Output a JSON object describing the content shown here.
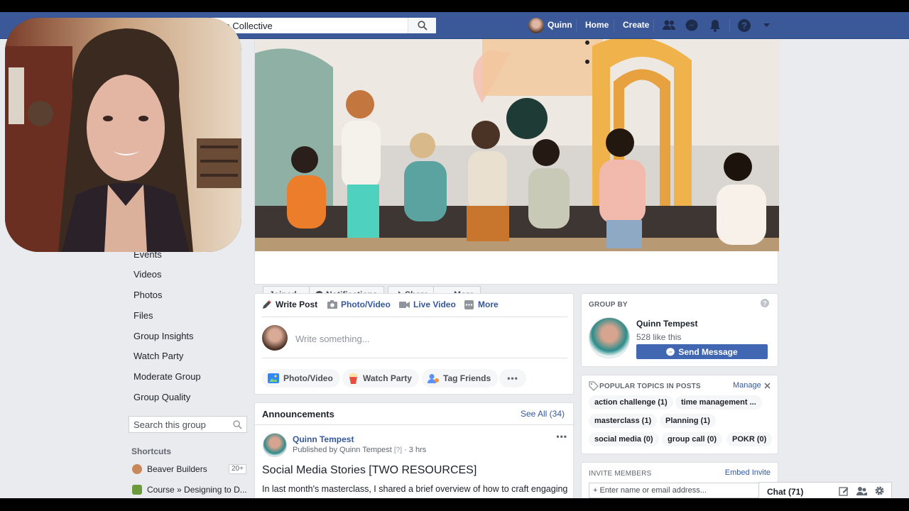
{
  "topbar": {
    "search_value": "urpose Collective",
    "user_name": "Quinn",
    "home": "Home",
    "create": "Create"
  },
  "left_nav": {
    "items": [
      "Events",
      "Videos",
      "Photos",
      "Files",
      "Group Insights",
      "Watch Party",
      "Moderate Group",
      "Group Quality"
    ],
    "search_placeholder": "Search this group",
    "shortcuts_title": "Shortcuts",
    "shortcuts": [
      {
        "label": "Beaver Builders",
        "badge": "20+"
      },
      {
        "label": "Course » Designing to D..."
      }
    ]
  },
  "cover_actions": {
    "joined": "Joined",
    "notifications": "Notifications",
    "share": "Share",
    "more": "More"
  },
  "composer": {
    "tabs": [
      "Write Post",
      "Photo/Video",
      "Live Video",
      "More"
    ],
    "placeholder": "Write something...",
    "pills": [
      "Photo/Video",
      "Watch Party",
      "Tag Friends"
    ]
  },
  "announcements": {
    "title": "Announcements",
    "see_all": "See All (34)",
    "author": "Quinn Tempest",
    "meta_prefix": "Published by Quinn Tempest",
    "meta_badge": "[?]",
    "meta_time": "· 3 hrs",
    "post_title": "Social Media Stories [TWO RESOURCES]",
    "post_text": "In last month's masterclass, I shared a brief overview of how to craft engaging"
  },
  "group_by": {
    "header": "GROUP BY",
    "name": "Quinn Tempest",
    "likes": "528 like this",
    "button": "Send Message"
  },
  "topics": {
    "header": "POPULAR TOPICS IN POSTS",
    "manage": "Manage",
    "items": [
      "action challenge (1)",
      "time management ...",
      "masterclass (1)",
      "Planning (1)",
      "social media (0)",
      "group call (0)",
      "POKR (0)"
    ]
  },
  "invite": {
    "header": "INVITE MEMBERS",
    "embed": "Embed Invite",
    "placeholder": "+ Enter name or email address..."
  },
  "chat": {
    "label": "Chat (71)"
  },
  "colors": {
    "brand": "#3b5998",
    "link": "#365899",
    "send_button": "#4267b2"
  }
}
